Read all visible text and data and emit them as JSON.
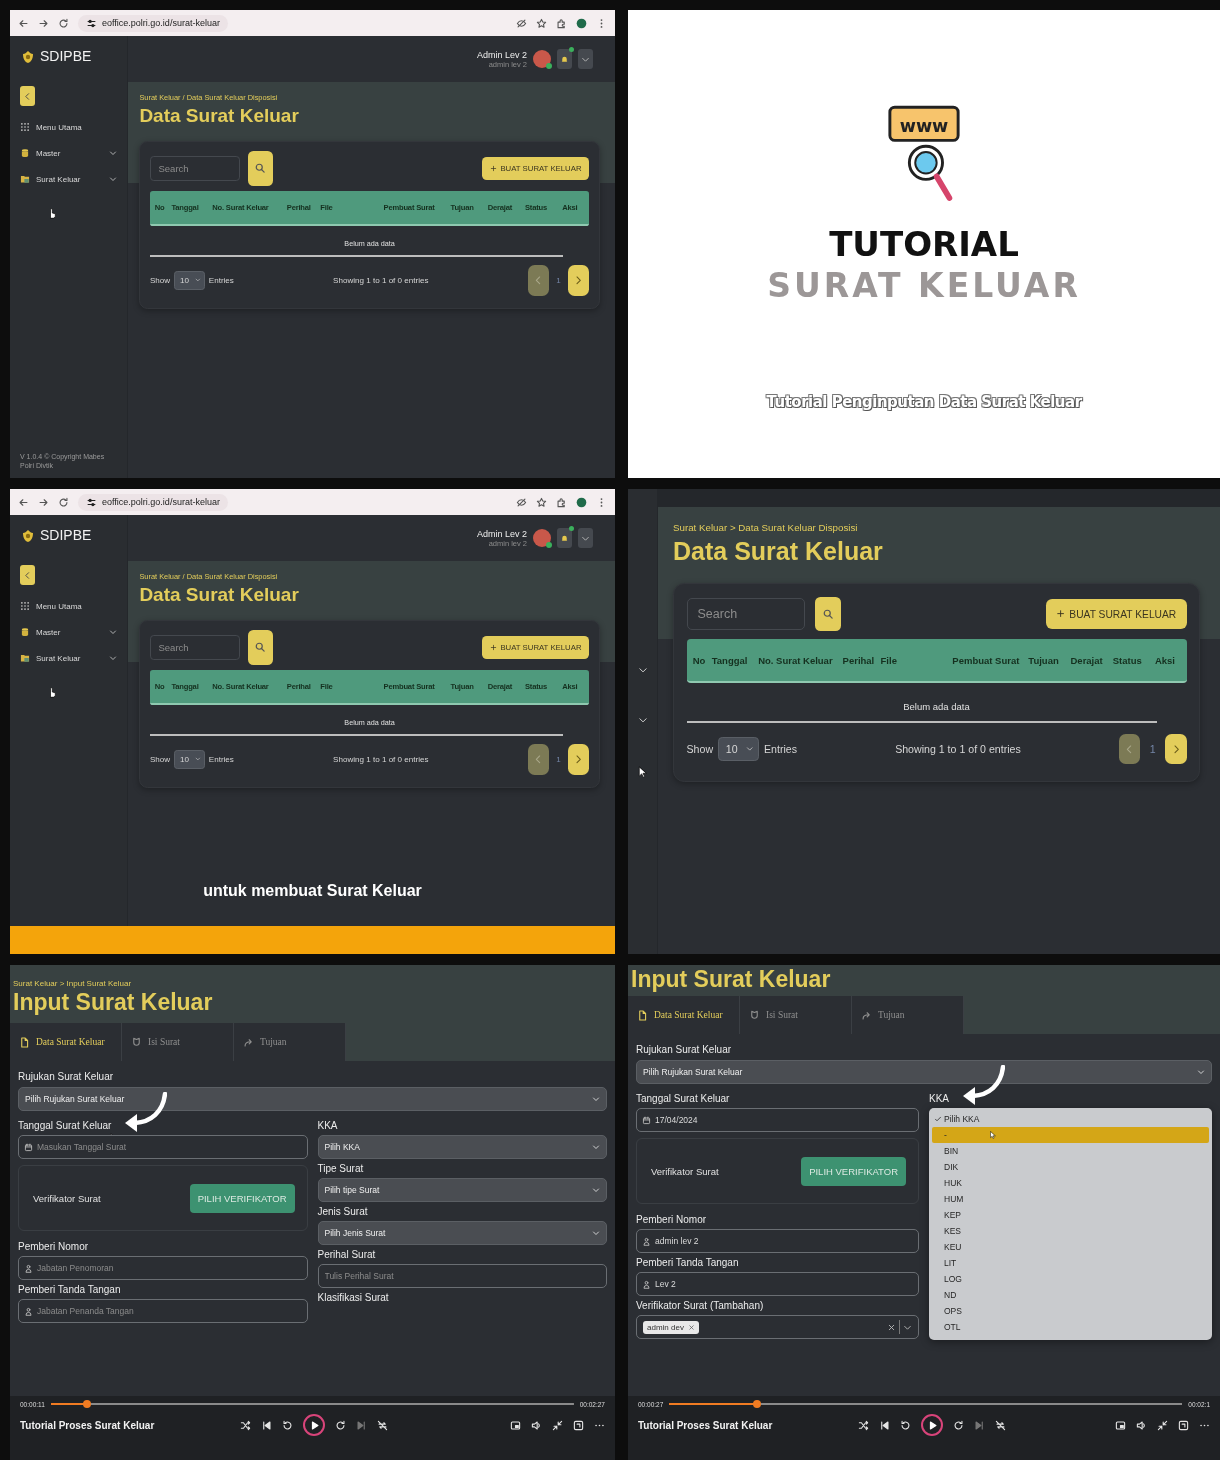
{
  "panels": [
    {
      "kind": "data_list",
      "browser": {
        "url": "eoffice.polri.go.id/surat-keluar"
      },
      "sidebar": {
        "brand": "SDIPBE",
        "collapse_button": true,
        "menu": [
          {
            "label": "Menu Utama",
            "expandable": false
          },
          {
            "label": "Master",
            "expandable": true
          },
          {
            "label": "Surat Keluar",
            "expandable": true
          }
        ],
        "footer": "V 1.0.4 © Copyright Mabes Polri Divtik"
      },
      "header": {
        "user_name": "Admin Lev 2",
        "user_role": "admin lev 2"
      },
      "breadcrumb": "Surat Keluar / Data Surat Keluar Disposisi",
      "title": "Data Surat Keluar",
      "search": {
        "placeholder": "Search"
      },
      "create_button": "BUAT SURAT KELUAR",
      "columns": [
        "No",
        "Tanggal",
        "No. Surat Keluar",
        "Perihal",
        "File",
        "Pembuat Surat",
        "Tujuan",
        "Derajat",
        "Status",
        "Aksi"
      ],
      "empty_text": "Belum ada data",
      "show_label": "Show",
      "page_size": "10",
      "entries_label": "Entries",
      "info": "Showing 1 to 1 of 0 entries",
      "page": "1",
      "prev_disabled": true,
      "next_disabled": false
    },
    {
      "kind": "title_slide",
      "icon_text": "www",
      "title": "TUTORIAL",
      "subtitle": "SURAT KELUAR",
      "caption": "Tutorial Penginputan Data Surat Keluar"
    },
    {
      "kind": "data_list",
      "browser": {
        "url": "eoffice.polri.go.id/surat-keluar"
      },
      "sidebar": {
        "brand": "SDIPBE",
        "collapse_button": true,
        "menu": [
          {
            "label": "Menu Utama",
            "expandable": false
          },
          {
            "label": "Master",
            "expandable": true
          },
          {
            "label": "Surat Keluar",
            "expandable": true
          }
        ]
      },
      "header": {
        "user_name": "Admin Lev 2",
        "user_role": "admin lev 2"
      },
      "breadcrumb": "Surat Keluar / Data Surat Keluar Disposisi",
      "title": "Data Surat Keluar",
      "search": {
        "placeholder": "Search"
      },
      "create_button": "BUAT SURAT KELUAR",
      "columns": [
        "No",
        "Tanggal",
        "No. Surat Keluar",
        "Perihal",
        "File",
        "Pembuat Surat",
        "Tujuan",
        "Derajat",
        "Status",
        "Aksi"
      ],
      "empty_text": "Belum ada data",
      "show_label": "Show",
      "page_size": "10",
      "entries_label": "Entries",
      "info": "Showing 1 to 1 of 0 entries",
      "page": "1",
      "prev_disabled": true,
      "next_disabled": false,
      "caption": "untuk membuat Surat Keluar",
      "caption_bar": true
    },
    {
      "kind": "data_list_zoomed",
      "sidebar": {
        "menu": [
          {
            "expandable": true
          },
          {
            "expandable": true
          }
        ]
      },
      "breadcrumb": "Surat Keluar > Data Surat Keluar Disposisi",
      "title": "Data Surat Keluar",
      "search": {
        "placeholder": "Search"
      },
      "create_button": "BUAT SURAT KELUAR",
      "columns": [
        "No",
        "Tanggal",
        "No. Surat Keluar",
        "Perihal",
        "File",
        "Pembuat Surat",
        "Tujuan",
        "Derajat",
        "Status",
        "Aksi"
      ],
      "empty_text": "Belum ada data",
      "show_label": "Show",
      "page_size": "10",
      "entries_label": "Entries",
      "info": "Showing 1 to 1 of 0 entries",
      "page": "1",
      "prev_disabled": true,
      "next_disabled": false
    },
    {
      "kind": "input_form",
      "breadcrumb": "Surat Keluar > Input Surat Keluar",
      "title": "Input Surat Keluar",
      "tabs": [
        {
          "label": "Data Surat Keluar",
          "selected": true
        },
        {
          "label": "Isi Surat",
          "selected": false
        },
        {
          "label": "Tujuan",
          "selected": false
        }
      ],
      "full_fields": [
        {
          "kind": "select",
          "label": "Rujukan Surat Keluar",
          "value": "Pilih Rujukan Surat Keluar"
        }
      ],
      "left_fields": [
        {
          "kind": "date",
          "label": "Tanggal Surat Keluar",
          "placeholder": "Masukan Tanggal Surat",
          "pointed": true
        },
        {
          "kind": "verifier",
          "label": "Verifikator Surat",
          "button": "PILIH VERIFIKATOR"
        },
        {
          "kind": "person",
          "label": "Pemberi Nomor",
          "placeholder": "Jabatan Penomoran"
        },
        {
          "kind": "person",
          "label": "Pemberi Tanda Tangan",
          "placeholder": "Jabatan Penanda Tangan"
        }
      ],
      "right_fields": [
        {
          "kind": "select",
          "label": "KKA",
          "value": "Pilih KKA"
        },
        {
          "kind": "select",
          "label": "Tipe Surat",
          "value": "Pilih tipe Surat"
        },
        {
          "kind": "select",
          "label": "Jenis Surat",
          "value": "Pilih Jenis Surat"
        },
        {
          "kind": "text",
          "label": "Perihal Surat",
          "placeholder": "Tulis Perihal Surat"
        },
        {
          "kind": "heading",
          "label": "Klasifikasi Surat"
        }
      ],
      "player": {
        "title": "Tutorial Proses Surat Keluar",
        "elapsed": "00:00:11",
        "duration": "00:02:27",
        "level": 0.07
      }
    },
    {
      "kind": "input_form",
      "title": "Input Surat Keluar",
      "tabs": [
        {
          "label": "Data Surat Keluar",
          "selected": true
        },
        {
          "label": "Isi Surat",
          "selected": false
        },
        {
          "label": "Tujuan",
          "selected": false
        }
      ],
      "full_fields": [
        {
          "kind": "select",
          "label": "Rujukan Surat Keluar",
          "value": "Pilih Rujukan Surat Keluar"
        }
      ],
      "left_fields": [
        {
          "kind": "date",
          "label": "Tanggal Surat Keluar",
          "value": "17/04/2024"
        },
        {
          "kind": "verifier",
          "label": "Verifikator Surat",
          "button": "PILIH VERIFIKATOR"
        },
        {
          "kind": "person",
          "label": "Pemberi Nomor",
          "value": "admin lev 2"
        },
        {
          "kind": "person",
          "label": "Pemberi Tanda Tangan",
          "value": "Lev 2"
        },
        {
          "kind": "multi",
          "label": "Verifikator Surat (Tambahan)",
          "chips": [
            "admin dev"
          ]
        }
      ],
      "right_fields": [
        {
          "kind": "select",
          "label": "KKA",
          "pointed": true,
          "dropdown": [
            {
              "label": "Pilih KKA",
              "checked": true,
              "highlighted": false
            },
            {
              "label": "-",
              "checked": false,
              "highlighted": true
            },
            {
              "label": "BIN",
              "checked": false,
              "highlighted": false
            },
            {
              "label": "DIK",
              "checked": false,
              "highlighted": false
            },
            {
              "label": "HUK",
              "checked": false,
              "highlighted": false
            },
            {
              "label": "HUM",
              "checked": false,
              "highlighted": false
            },
            {
              "label": "KEP",
              "checked": false,
              "highlighted": false
            },
            {
              "label": "KES",
              "checked": false,
              "highlighted": false
            },
            {
              "label": "KEU",
              "checked": false,
              "highlighted": false
            },
            {
              "label": "LIT",
              "checked": false,
              "highlighted": false
            },
            {
              "label": "LOG",
              "checked": false,
              "highlighted": false
            },
            {
              "label": "ND",
              "checked": false,
              "highlighted": false
            },
            {
              "label": "OPS",
              "checked": false,
              "highlighted": false
            },
            {
              "label": "OTL",
              "checked": false,
              "highlighted": false
            }
          ]
        }
      ],
      "player": {
        "title": "Tutorial Proses Surat Keluar",
        "elapsed": "00:00:27",
        "duration": "00:02:1",
        "level": 0.17
      }
    }
  ]
}
